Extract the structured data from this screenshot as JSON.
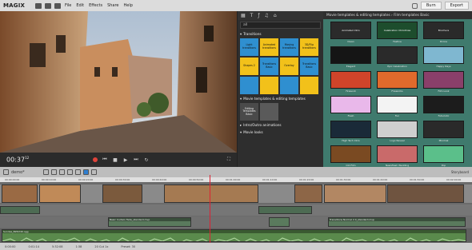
{
  "app": {
    "logo": "MAGIX",
    "menus": [
      "File",
      "Edit",
      "Effects",
      "Share",
      "Help"
    ],
    "burn_label": "Burn",
    "export_label": "Export"
  },
  "preview": {
    "timecode_main": "00:37",
    "timecode_frames": "12"
  },
  "media_pool": {
    "search_value": "all",
    "transitions_header": "Transitions",
    "movie_templates_header": "Movie templates & editing templates",
    "intro_outro_header": "Intro/Outro animations",
    "movie_looks_header": "Movie looks",
    "transition_tiles": [
      {
        "label": "Light transitions",
        "color": "#2f8fd0"
      },
      {
        "label": "Animated transitions",
        "color": "#f2c11a"
      },
      {
        "label": "Moving transitions",
        "color": "#2f8fd0"
      },
      {
        "label": "3D/Flip transitions",
        "color": "#f2c11a"
      },
      {
        "label": "Shapes 2",
        "color": "#f2c11a"
      },
      {
        "label": "Transitions Basic",
        "color": "#2f8fd0"
      },
      {
        "label": "Overlay",
        "color": "#f2c11a"
      },
      {
        "label": "Transitions Basic",
        "color": "#2f8fd0"
      },
      {
        "label": "",
        "color": "#2f8fd0"
      },
      {
        "label": "",
        "color": "#f2c11a"
      },
      {
        "label": "",
        "color": "#2f8fd0"
      },
      {
        "label": "",
        "color": "#f2c11a"
      }
    ],
    "template_tiles": [
      {
        "label": "Editing Templates Basic",
        "color": "#4a4a4a"
      },
      {
        "label": "",
        "color": "#5a5a5a"
      }
    ]
  },
  "browser": {
    "header": "Movie templates & editing templates › Film templates Basic",
    "tiles": [
      {
        "label": "Clean",
        "thumb": "Animated Intro",
        "color": "#2b2b2b"
      },
      {
        "label": "Festive",
        "thumb": "Celebration Christmas",
        "color": "#1d4d2d"
      },
      {
        "label": "Drone",
        "thumb": "Brochure",
        "color": "#2a2a2a"
      },
      {
        "label": "Elegant",
        "thumb": "",
        "color": "#151515"
      },
      {
        "label": "Epic Celebration",
        "thumb": "",
        "color": "#2a2a2a"
      },
      {
        "label": "Happy Days",
        "thumb": "",
        "color": "#7fb7d0"
      },
      {
        "label": "Firework",
        "thumb": "",
        "color": "#d0442a"
      },
      {
        "label": "Fireworks",
        "thumb": "",
        "color": "#e06a2c"
      },
      {
        "label": "Film Look",
        "thumb": "",
        "color": "#8a3f6a"
      },
      {
        "label": "Flash",
        "thumb": "",
        "color": "#e9b8ea"
      },
      {
        "label": "Fun",
        "thumb": "",
        "color": "#f3f3f3"
      },
      {
        "label": "Futuristic",
        "thumb": "",
        "color": "#1c1c1c"
      },
      {
        "label": "High Tech Intro",
        "thumb": "",
        "color": "#1a2a38"
      },
      {
        "label": "Logo Reveal",
        "thumb": "",
        "color": "#cfcfcf"
      },
      {
        "label": "Minimal",
        "thumb": "",
        "color": "#2a2a2a"
      },
      {
        "label": "Old Film",
        "thumb": "",
        "color": "#7a4a22"
      },
      {
        "label": "Newsflash Wedding",
        "thumb": "",
        "color": "#c96a6a"
      },
      {
        "label": "Pop",
        "thumb": "",
        "color": "#5bbf8a"
      }
    ]
  },
  "arranger": {
    "project_name": "demo*",
    "storyboard_label": "Storyboard",
    "ruler_labels": [
      "00:00:00:00",
      "00:00:10:00",
      "00:00:20:00",
      "00:00:30:00",
      "00:00:40:00",
      "00:00:50:00",
      "00:01:00:00",
      "00:01:10:00",
      "00:01:20:00",
      "00:01:30:00",
      "00:01:40:00",
      "00:01:50:00",
      "00:02:00:00"
    ],
    "audio_clip_label": "Sunrise_BZO240.ogg",
    "title_clip_labels": [
      "Basic Curtain Fade_standard.mvp",
      "Transitions Normal 2.0_standard.mvp"
    ],
    "status": [
      "0:00:00",
      "0:01:14",
      "5:32:08",
      "1:38",
      "20 Cut 1x",
      "Preset: 30"
    ]
  }
}
